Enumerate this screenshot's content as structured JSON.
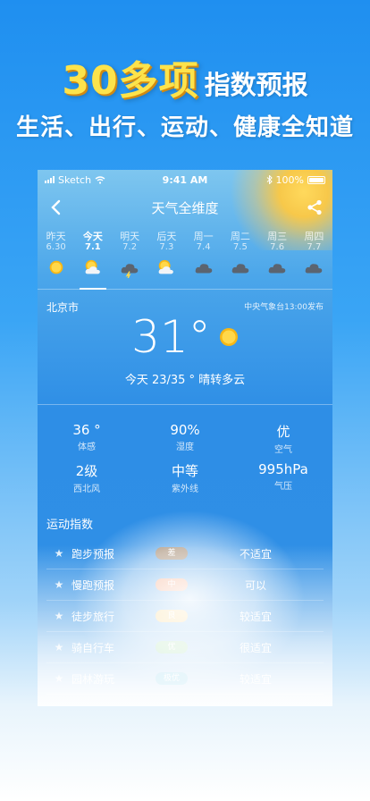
{
  "promo": {
    "headline_big": "30多项",
    "headline_small": "指数预报",
    "subline": "生活、出行、运动、健康全知道"
  },
  "status_bar": {
    "carrier": "Sketch",
    "time": "9:41 AM",
    "battery": "100%"
  },
  "nav": {
    "title": "天气全维度"
  },
  "days": [
    {
      "name": "昨天",
      "date": "6.30",
      "icon": "sunny-icon"
    },
    {
      "name": "今天",
      "date": "7.1",
      "icon": "partly-cloudy-icon",
      "active": true
    },
    {
      "name": "明天",
      "date": "7.2",
      "icon": "thunderstorm-icon"
    },
    {
      "name": "后天",
      "date": "7.3",
      "icon": "partly-cloudy-icon"
    },
    {
      "name": "周一",
      "date": "7.4",
      "icon": "cloudy-icon"
    },
    {
      "name": "周二",
      "date": "7.5",
      "icon": "cloudy-icon"
    },
    {
      "name": "周三",
      "date": "7.6",
      "icon": "cloudy-icon"
    },
    {
      "name": "周四",
      "date": "7.7",
      "icon": "cloudy-icon"
    }
  ],
  "current": {
    "city": "北京市",
    "source": "中央气象台13:00发布",
    "temperature": "31°",
    "summary": "今天 23/35 ° 晴转多云"
  },
  "stats": [
    {
      "value": "36 °",
      "label": "体感"
    },
    {
      "value": "90%",
      "label": "湿度"
    },
    {
      "value": "优",
      "label": "空气"
    },
    {
      "value": "2级",
      "label": "西北风"
    },
    {
      "value": "中等",
      "label": "紫外线"
    },
    {
      "value": "995hPa",
      "label": "气压"
    }
  ],
  "sports": {
    "title": "运动指数",
    "items": [
      {
        "name": "跑步预报",
        "level": "差",
        "advice": "不适宜",
        "color": "#8a6a4a"
      },
      {
        "name": "慢跑预报",
        "level": "中",
        "advice": "可以",
        "color": "#f28a5a"
      },
      {
        "name": "徒步旅行",
        "level": "良",
        "advice": "较适宜",
        "color": "#f5c04a"
      },
      {
        "name": "骑自行车",
        "level": "优",
        "advice": "很适宜",
        "color": "#7fd18a"
      },
      {
        "name": "园林游玩",
        "level": "极优",
        "advice": "较适宜",
        "color": "#6cc7e8"
      }
    ]
  }
}
